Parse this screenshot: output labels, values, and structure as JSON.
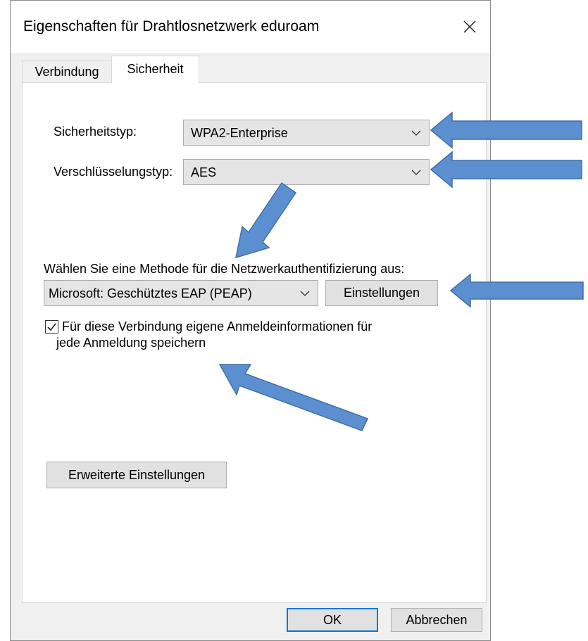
{
  "dialog": {
    "title": "Eigenschaften für Drahtlosnetzwerk eduroam",
    "close_icon": "close-icon"
  },
  "tabs": [
    {
      "label": "Verbindung",
      "active": false
    },
    {
      "label": "Sicherheit",
      "active": true
    }
  ],
  "security": {
    "type_label": "Sicherheitstyp:",
    "type_value": "WPA2-Enterprise",
    "encryption_label": "Verschlüsselungstyp:",
    "encryption_value": "AES",
    "method_label": "Wählen Sie eine Methode für die Netzwerkauthentifizierung aus:",
    "method_value": "Microsoft: Geschütztes EAP (PEAP)",
    "settings_button": "Einstellungen",
    "remember_line1": "Für diese Verbindung eigene Anmeldeinformationen für",
    "remember_line2": "jede Anmeldung speichern",
    "remember_checked": true,
    "advanced_button": "Erweiterte Einstellungen"
  },
  "footer": {
    "ok": "OK",
    "cancel": "Abbrechen"
  },
  "colors": {
    "arrow_fill": "#5b8fd0",
    "arrow_stroke": "#3e6fa8",
    "focus_border": "#0078d7"
  }
}
